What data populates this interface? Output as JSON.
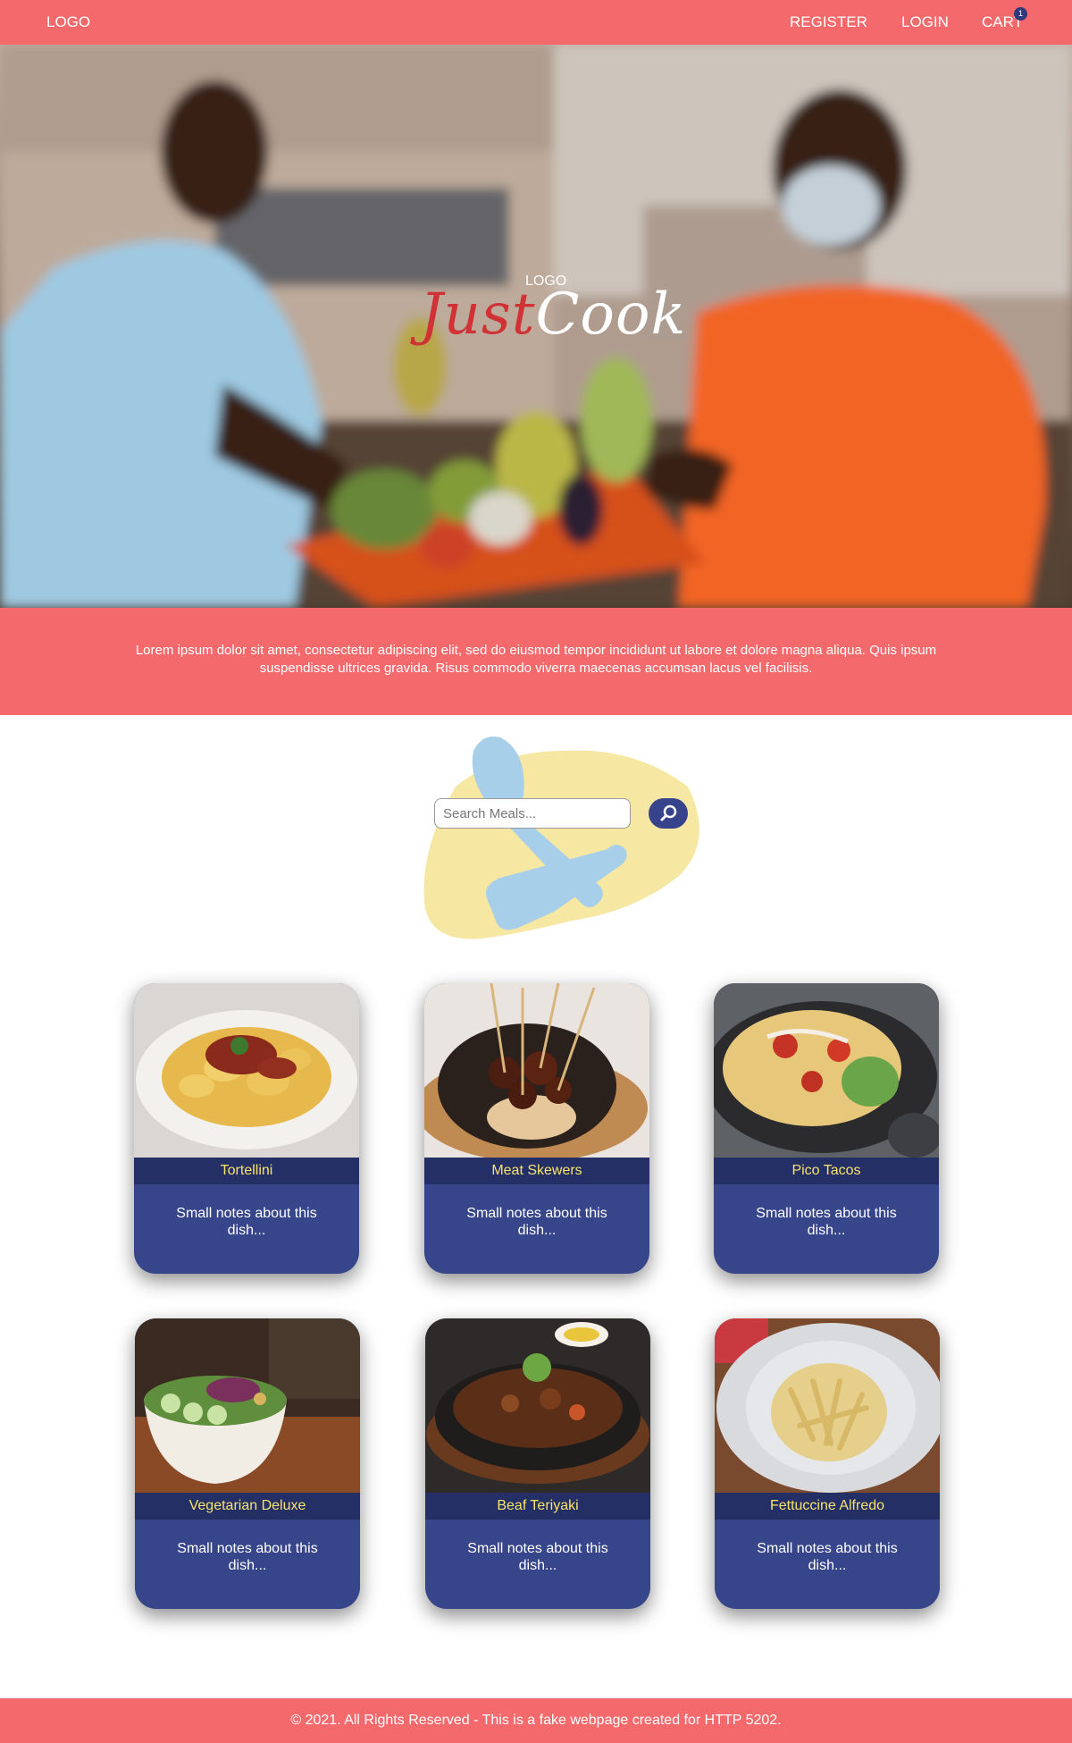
{
  "nav": {
    "logo": "LOGO",
    "register": "REGISTER",
    "login": "LOGIN",
    "cart": "CART",
    "cart_count": "1"
  },
  "hero": {
    "logo_small": "LOGO",
    "brand_part1": "Just",
    "brand_part2": "Cook"
  },
  "intro": {
    "text": "Lorem ipsum dolor sit amet, consectetur adipiscing elit, sed do eiusmod tempor incididunt ut labore et dolore magna aliqua. Quis ipsum suspendisse ultrices gravida. Risus commodo viverra maecenas accumsan lacus vel facilisis."
  },
  "search": {
    "placeholder": "Search Meals...",
    "icon": "search-icon"
  },
  "meals": [
    {
      "name": "Tortellini",
      "notes": "Small notes about this dish..."
    },
    {
      "name": "Meat Skewers",
      "notes": "Small notes about this dish..."
    },
    {
      "name": "Pico Tacos",
      "notes": "Small notes about this dish..."
    },
    {
      "name": "Vegetarian Deluxe",
      "notes": "Small notes about this dish..."
    },
    {
      "name": "Beaf Teriyaki",
      "notes": "Small notes about this dish..."
    },
    {
      "name": "Fettuccine Alfredo",
      "notes": "Small notes about this dish..."
    }
  ],
  "footer": {
    "text": "© 2021. All Rights Reserved - This is a fake webpage created for HTTP 5202."
  },
  "colors": {
    "primary": "#f4696c",
    "navy": "#37468a",
    "dark_navy": "#242f66",
    "accent_yellow": "#f7e36b",
    "blob_yellow": "#f6e7a3",
    "blob_blue": "#a7cfea"
  }
}
